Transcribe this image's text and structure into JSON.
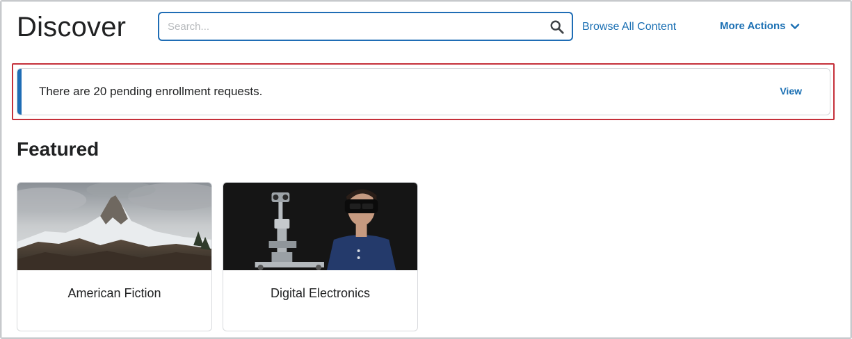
{
  "header": {
    "title": "Discover",
    "search": {
      "placeholder": "Search...",
      "value": ""
    },
    "browse_label": "Browse All Content",
    "more_actions_label": "More Actions"
  },
  "alert": {
    "message": "There are 20 pending enrollment requests.",
    "action_label": "View",
    "accent": "#1f6db5",
    "highlight": "#c5303a"
  },
  "featured": {
    "title": "Featured",
    "cards": [
      {
        "label": "American Fiction",
        "image": "mountain-landscape"
      },
      {
        "label": "Digital Electronics",
        "image": "vr-headset-person"
      }
    ]
  },
  "colors": {
    "link": "#1a6fb3",
    "text": "#202122"
  }
}
